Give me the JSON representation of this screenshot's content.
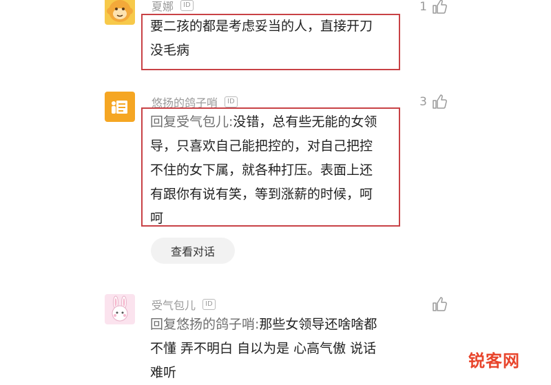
{
  "comments": [
    {
      "username": "夏娜",
      "id_badge": "ID",
      "likes": "1",
      "lines": [
        "要二孩的都是考虑妥当的人，直接开刀",
        "没毛病"
      ]
    },
    {
      "username": "悠扬的鸽子哨",
      "id_badge": "ID",
      "likes": "3",
      "reply_prefix": "回复受气包儿:",
      "lines": [
        "没错，总有些无能的女领",
        "导，只喜欢自己能把控的，对自己把控",
        "不住的女下属，就各种打压。表面上还",
        "有跟你有说有笑，等到涨薪的时候，呵",
        "呵"
      ],
      "view_dialog_label": "查看对话"
    },
    {
      "username": "受气包儿",
      "id_badge": "ID",
      "likes": "",
      "reply_prefix": "回复悠扬的鸽子哨:",
      "lines": [
        "那些女领导还啥啥都",
        "不懂 弄不明白 自以为是 心高气傲 说话",
        "难听"
      ]
    }
  ],
  "watermark": "锐客网",
  "colors": {
    "highlight_border": "#c84145",
    "muted": "#9a9a9a",
    "watermark": "#e8442b"
  },
  "icons": [
    "monkey-avatar-icon",
    "document-avatar-icon",
    "rabbit-avatar-icon",
    "thumbs-up-icon"
  ]
}
